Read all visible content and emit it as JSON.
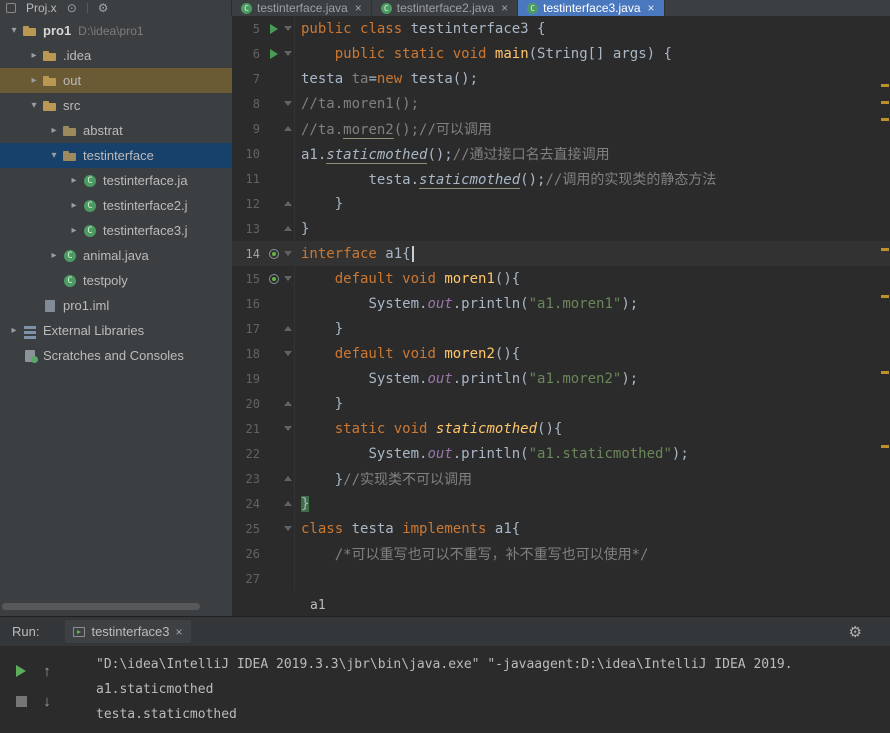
{
  "colors": {
    "editor_bg": "#2B2B2B",
    "panel_bg": "#3C3F41",
    "active_tab": "#4A78BE",
    "keyword": "#CC7832",
    "plain_text": "#A9B7C6",
    "comment": "#808080",
    "string": "#6A8759",
    "method": "#FFC66B",
    "field": "#9876AA",
    "line_number": "#606366",
    "current_line": "#323232",
    "tree_selection_blue": "#17406B",
    "tree_selection_brown": "#6A5B34",
    "run_green": "#499C54",
    "warning_stripe": "#BE9127"
  },
  "project_header": {
    "title": "Proj.x",
    "icons": {
      "locate": "⊙",
      "gear": "⚙"
    }
  },
  "editor_tabs": [
    {
      "label": "testinterface.java",
      "close": "×",
      "active": false
    },
    {
      "label": "testinterface2.java",
      "close": "×",
      "active": false
    },
    {
      "label": "testinterface3.java",
      "close": "×",
      "active": true
    }
  ],
  "project_tree": [
    {
      "label": "pro1",
      "path": "D:\\idea\\pro1",
      "level": 0,
      "arrow": "▾",
      "icon": "folder",
      "bold": true,
      "highlight": ""
    },
    {
      "label": ".idea",
      "level": 1,
      "arrow": "▸",
      "icon": "folder",
      "highlight": ""
    },
    {
      "label": "out",
      "level": 1,
      "arrow": "▸",
      "icon": "folder",
      "highlight": "brown"
    },
    {
      "label": "src",
      "level": 1,
      "arrow": "▾",
      "icon": "folder",
      "highlight": ""
    },
    {
      "label": "abstrat",
      "level": 2,
      "arrow": "▸",
      "icon": "package",
      "highlight": ""
    },
    {
      "label": "testinterface",
      "level": 2,
      "arrow": "▾",
      "icon": "package",
      "highlight": "blue"
    },
    {
      "label": "testinterface.ja",
      "level": 3,
      "arrow": "▸",
      "icon": "class",
      "highlight": ""
    },
    {
      "label": "testinterface2.j",
      "level": 3,
      "arrow": "▸",
      "icon": "class",
      "highlight": ""
    },
    {
      "label": "testinterface3.j",
      "level": 3,
      "arrow": "▸",
      "icon": "class",
      "highlight": ""
    },
    {
      "label": "animal.java",
      "level": 2,
      "arrow": "▸",
      "icon": "class",
      "highlight": ""
    },
    {
      "label": "testpoly",
      "level": 2,
      "arrow": "",
      "icon": "class",
      "highlight": ""
    },
    {
      "label": "pro1.iml",
      "level": 1,
      "arrow": "",
      "icon": "file",
      "highlight": ""
    },
    {
      "label": "External Libraries",
      "level": 0,
      "arrow": "▸",
      "icon": "lib",
      "highlight": ""
    },
    {
      "label": "Scratches and Consoles",
      "level": 0,
      "arrow": "",
      "icon": "scratch",
      "highlight": ""
    }
  ],
  "editor": {
    "stripe_marks": [
      84,
      101,
      118,
      248,
      295,
      371,
      445
    ],
    "lines": [
      {
        "n": 5,
        "ind": 0,
        "run": true,
        "fold": "start",
        "seg": [
          [
            "c-kw",
            "public"
          ],
          [
            "c-pl",
            " "
          ],
          [
            "c-kw",
            "class"
          ],
          [
            "c-pl",
            " "
          ],
          [
            "c-pl m-u",
            "testinterface3"
          ],
          [
            "c-pl",
            " {"
          ]
        ]
      },
      {
        "n": 6,
        "ind": 4,
        "run": true,
        "fold": "start",
        "seg": [
          [
            "c-kw",
            "public"
          ],
          [
            "c-pl",
            " "
          ],
          [
            "c-kw",
            "static"
          ],
          [
            "c-pl",
            " "
          ],
          [
            "c-kw",
            "void"
          ],
          [
            "c-pl",
            " "
          ],
          [
            "c-md",
            "main"
          ],
          [
            "c-pl",
            "(String[] args) {"
          ]
        ]
      },
      {
        "n": 7,
        "ind": 0,
        "seg": [
          [
            "c-pl",
            "testa "
          ],
          [
            "c-gr",
            "ta"
          ],
          [
            "c-pl",
            "="
          ],
          [
            "c-kw",
            "new"
          ],
          [
            "c-pl",
            " testa();"
          ]
        ]
      },
      {
        "n": 8,
        "ind": 0,
        "fold": "start",
        "seg": [
          [
            "c-cm",
            "//ta."
          ],
          [
            "c-cm m-u",
            "moren1"
          ],
          [
            "c-cm",
            "();"
          ]
        ]
      },
      {
        "n": 9,
        "ind": 0,
        "fold": "end",
        "seg": [
          [
            "c-cm",
            "//ta."
          ],
          [
            "c-cm m-u",
            "moren2"
          ],
          [
            "c-cm",
            "();//可以调用"
          ]
        ]
      },
      {
        "n": 10,
        "ind": 0,
        "seg": [
          [
            "c-pl",
            "a1."
          ],
          [
            "c-pl m-i m-u",
            "staticmothed"
          ],
          [
            "c-pl",
            "();"
          ],
          [
            "c-cm",
            "//通过接口名去直接调用"
          ]
        ]
      },
      {
        "n": 11,
        "ind": 8,
        "seg": [
          [
            "c-pl",
            "testa."
          ],
          [
            "c-pl m-i m-u",
            "staticmothed"
          ],
          [
            "c-pl",
            "();"
          ],
          [
            "c-cm",
            "//调用的实现类的静态方法"
          ]
        ]
      },
      {
        "n": 12,
        "ind": 4,
        "fold": "end",
        "seg": [
          [
            "c-pl",
            "}"
          ]
        ]
      },
      {
        "n": 13,
        "ind": 0,
        "fold": "end",
        "seg": [
          [
            "c-pl",
            "}"
          ]
        ]
      },
      {
        "n": 14,
        "ind": 0,
        "current": true,
        "impl": true,
        "fold": "start",
        "seg": [
          [
            "c-kw",
            "interface"
          ],
          [
            "c-pl",
            " a1{"
          ],
          [
            "caret",
            ""
          ]
        ]
      },
      {
        "n": 15,
        "ind": 4,
        "impl": true,
        "fold": "start",
        "seg": [
          [
            "c-kw",
            "default"
          ],
          [
            "c-pl",
            " "
          ],
          [
            "c-kw",
            "void"
          ],
          [
            "c-pl",
            " "
          ],
          [
            "c-md m-u",
            "moren1"
          ],
          [
            "c-pl",
            "(){"
          ]
        ]
      },
      {
        "n": 16,
        "ind": 8,
        "seg": [
          [
            "c-pl",
            "System."
          ],
          [
            "c-fi",
            "out"
          ],
          [
            "c-pl",
            ".println("
          ],
          [
            "c-st",
            "\"a1."
          ],
          [
            "c-st m-u",
            "moren1"
          ],
          [
            "c-st",
            "\""
          ],
          [
            "c-pl",
            ");"
          ]
        ]
      },
      {
        "n": 17,
        "ind": 4,
        "fold": "end",
        "seg": [
          [
            "c-pl",
            "}"
          ]
        ]
      },
      {
        "n": 18,
        "ind": 4,
        "fold": "start",
        "seg": [
          [
            "c-kw",
            "default"
          ],
          [
            "c-pl",
            " "
          ],
          [
            "c-kw",
            "void"
          ],
          [
            "c-pl",
            " "
          ],
          [
            "c-md m-u",
            "moren2"
          ],
          [
            "c-pl",
            "(){"
          ]
        ]
      },
      {
        "n": 19,
        "ind": 8,
        "seg": [
          [
            "c-pl",
            "System."
          ],
          [
            "c-fi",
            "out"
          ],
          [
            "c-pl",
            ".println("
          ],
          [
            "c-st",
            "\"a1."
          ],
          [
            "c-st m-u",
            "moren2"
          ],
          [
            "c-st",
            "\""
          ],
          [
            "c-pl",
            ");"
          ]
        ]
      },
      {
        "n": 20,
        "ind": 4,
        "fold": "end",
        "seg": [
          [
            "c-pl",
            "}"
          ]
        ]
      },
      {
        "n": 21,
        "ind": 4,
        "fold": "start",
        "seg": [
          [
            "c-kw",
            "static"
          ],
          [
            "c-pl",
            " "
          ],
          [
            "c-kw",
            "void"
          ],
          [
            "c-pl",
            " "
          ],
          [
            "c-md m-i m-u",
            "staticmothed"
          ],
          [
            "c-pl",
            "(){"
          ]
        ]
      },
      {
        "n": 22,
        "ind": 8,
        "seg": [
          [
            "c-pl",
            "System."
          ],
          [
            "c-fi",
            "out"
          ],
          [
            "c-pl",
            ".println("
          ],
          [
            "c-st",
            "\"a1."
          ],
          [
            "c-st m-u",
            "staticmothed"
          ],
          [
            "c-st",
            "\""
          ],
          [
            "c-pl",
            ");"
          ]
        ]
      },
      {
        "n": 23,
        "ind": 4,
        "fold": "end",
        "seg": [
          [
            "c-pl",
            "}"
          ],
          [
            "c-cm",
            "//实现类不可以调用"
          ]
        ]
      },
      {
        "n": 24,
        "ind": 0,
        "fold": "end",
        "seg": [
          [
            "c-pl m-brace",
            "}"
          ]
        ]
      },
      {
        "n": 25,
        "ind": 0,
        "fold": "start",
        "seg": [
          [
            "c-kw",
            "class"
          ],
          [
            "c-pl",
            " "
          ],
          [
            "c-pl m-u",
            "testa"
          ],
          [
            "c-pl",
            " "
          ],
          [
            "c-kw",
            "implements"
          ],
          [
            "c-pl",
            " a1{"
          ]
        ]
      },
      {
        "n": 26,
        "ind": 4,
        "seg": [
          [
            "c-cm",
            "/*可以重写也可以不重写，补不重写也可以使用*/"
          ]
        ]
      },
      {
        "n": 27,
        "ind": 0,
        "seg": []
      }
    ]
  },
  "breadcrumb": {
    "label": "a1"
  },
  "run_panel": {
    "title": "Run:",
    "tab": {
      "label": "testinterface3",
      "close": "×"
    },
    "gear": "⚙",
    "toolbar": {
      "up": "↑",
      "down": "↓"
    },
    "console": [
      "\"D:\\idea\\IntelliJ IDEA 2019.3.3\\jbr\\bin\\java.exe\" \"-javaagent:D:\\idea\\IntelliJ IDEA 2019.",
      "a1.staticmothed",
      "testa.staticmothed"
    ]
  }
}
